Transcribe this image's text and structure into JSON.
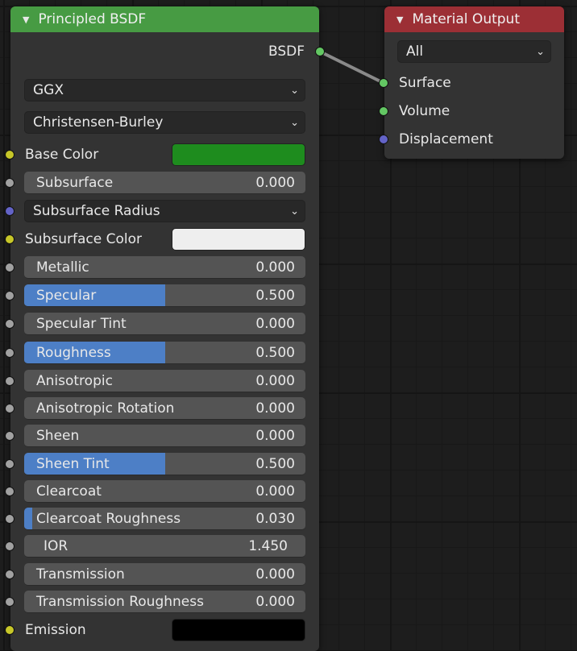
{
  "nodes": {
    "bsdf": {
      "title": "Principled BSDF",
      "header_color": "#479b43",
      "output_socket": "BSDF",
      "distribution": "GGX",
      "subsurface_method": "Christensen-Burley",
      "inputs": {
        "base_color": {
          "label": "Base Color",
          "color": "#1e8c1e"
        },
        "subsurface": {
          "label": "Subsurface",
          "value": "0.000",
          "fraction": 0
        },
        "subsurface_radius": {
          "label": "Subsurface Radius"
        },
        "subsurface_color": {
          "label": "Subsurface Color",
          "color": "#eeeeee"
        },
        "metallic": {
          "label": "Metallic",
          "value": "0.000",
          "fraction": 0
        },
        "specular": {
          "label": "Specular",
          "value": "0.500",
          "fraction": 0.5
        },
        "specular_tint": {
          "label": "Specular Tint",
          "value": "0.000",
          "fraction": 0
        },
        "roughness": {
          "label": "Roughness",
          "value": "0.500",
          "fraction": 0.5
        },
        "anisotropic": {
          "label": "Anisotropic",
          "value": "0.000",
          "fraction": 0
        },
        "anisotropic_rotation": {
          "label": "Anisotropic Rotation",
          "value": "0.000",
          "fraction": 0
        },
        "sheen": {
          "label": "Sheen",
          "value": "0.000",
          "fraction": 0
        },
        "sheen_tint": {
          "label": "Sheen Tint",
          "value": "0.500",
          "fraction": 0.5
        },
        "clearcoat": {
          "label": "Clearcoat",
          "value": "0.000",
          "fraction": 0
        },
        "clearcoat_roughness": {
          "label": "Clearcoat Roughness",
          "value": "0.030",
          "fraction": 0.03
        },
        "ior": {
          "label": "IOR",
          "value": "1.450"
        },
        "transmission": {
          "label": "Transmission",
          "value": "0.000",
          "fraction": 0
        },
        "transmission_roughness": {
          "label": "Transmission Roughness",
          "value": "0.000",
          "fraction": 0
        },
        "emission": {
          "label": "Emission",
          "color": "#000000"
        }
      }
    },
    "material_output": {
      "title": "Material Output",
      "header_color": "#9c2f35",
      "target": "All",
      "inputs": {
        "surface": "Surface",
        "volume": "Volume",
        "displacement": "Displacement"
      }
    }
  },
  "icons": {
    "collapse": "▼",
    "chevron": "⌄"
  }
}
